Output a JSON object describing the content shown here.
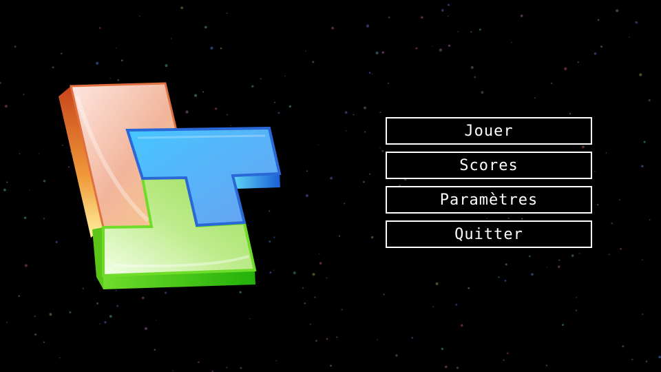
{
  "menu": {
    "play_label": "Jouer",
    "scores_label": "Scores",
    "settings_label": "Paramètres",
    "quit_label": "Quitter"
  },
  "logo": {
    "icon": "tetromino-logo-icon",
    "colors": {
      "orange_piece": "#e8703a",
      "blue_piece": "#3fb8f0",
      "green_piece": "#7ed321"
    }
  },
  "background": {
    "color": "#000000"
  }
}
